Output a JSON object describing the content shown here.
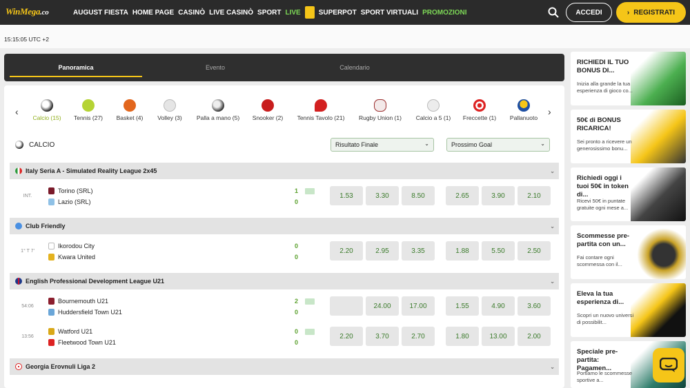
{
  "header": {
    "logo_main": "WinMega",
    "logo_suffix": ".co",
    "nav": [
      "AUGUST FIESTA",
      "HOME PAGE",
      "CASINÒ",
      "LIVE CASINÒ",
      "SPORT",
      "LIVE",
      "SUPERPOT",
      "SPORT VIRTUALI",
      "PROMOZIONI"
    ],
    "login": "ACCEDI",
    "register": "REGISTRATI",
    "accent": "#f5c518"
  },
  "time": "15:15:05 UTC +2",
  "tabs": [
    "Panoramica",
    "Evento",
    "Calendario"
  ],
  "sports": [
    {
      "label": "Calcio (15)",
      "icon": "soccer-ball-icon"
    },
    {
      "label": "Tennis (27)",
      "icon": "tennis-ball-icon"
    },
    {
      "label": "Basket (4)",
      "icon": "basketball-icon"
    },
    {
      "label": "Volley (3)",
      "icon": "volleyball-icon"
    },
    {
      "label": "Palla a mano (5)",
      "icon": "handball-icon"
    },
    {
      "label": "Snooker (2)",
      "icon": "snooker-ball-icon"
    },
    {
      "label": "Tennis Tavolo (21)",
      "icon": "table-tennis-icon"
    },
    {
      "label": "Rugby Union (1)",
      "icon": "rugby-ball-icon"
    },
    {
      "label": "Calcio a 5 (1)",
      "icon": "futsal-ball-icon"
    },
    {
      "label": "Freccette (1)",
      "icon": "darts-icon"
    },
    {
      "label": "Pallanuoto",
      "icon": "water-polo-icon"
    }
  ],
  "section": {
    "title": "CALCIO",
    "select1": "Risultato Finale",
    "select2": "Prossimo Goal"
  },
  "leagues": [
    {
      "name": "Italy Seria A - Simulated Reality League 2x45"
    },
    {
      "name": "Club Friendly"
    },
    {
      "name": "English Professional Development League U21"
    },
    {
      "name": "Georgia Erovnuli Liga 2"
    }
  ],
  "matches": [
    {
      "time": "INT.",
      "home": "Torino (SRL)",
      "away": "Lazio (SRL)",
      "score_home": "1",
      "score_away": "0",
      "odds1": [
        "1.53",
        "3.30",
        "8.50"
      ],
      "odds2": [
        "2.65",
        "3.90",
        "2.10"
      ]
    },
    {
      "time": "1° T 7'",
      "home": "Ikorodou City",
      "away": "Kwara United",
      "score_home": "0",
      "score_away": "0",
      "odds1": [
        "2.20",
        "2.95",
        "3.35"
      ],
      "odds2": [
        "1.88",
        "5.50",
        "2.50"
      ]
    },
    {
      "time": "54:06",
      "home": "Bournemouth U21",
      "away": "Huddersfield Town U21",
      "score_home": "2",
      "score_away": "0",
      "odds1": [
        "",
        "24.00",
        "17.00"
      ],
      "odds2": [
        "1.55",
        "4.90",
        "3.60"
      ]
    },
    {
      "time": "13:56",
      "home": "Watford U21",
      "away": "Fleetwood Town U21",
      "score_home": "0",
      "score_away": "0",
      "odds1": [
        "2.20",
        "3.70",
        "2.70"
      ],
      "odds2": [
        "1.80",
        "13.00",
        "2.00"
      ]
    }
  ],
  "promos": [
    {
      "title": "RICHIEDI IL TUO BONUS DI...",
      "desc": "Inizia alla grande la tua esperienza di gioco co..."
    },
    {
      "title": "50€ di BONUS RICARICA!",
      "desc": "Sei pronto a ricevere un generosissimo bonu..."
    },
    {
      "title": "Richiedi oggi i tuoi 50€ in token di...",
      "desc": "Ricevi 50€ in puntate gratuite ogni mese a..."
    },
    {
      "title": "Scommesse pre-partita con un...",
      "desc": "Fai contare ogni scommessa con il..."
    },
    {
      "title": "Eleva la tua esperienza di...",
      "desc": "Scopri un nuovo universi di possibilit..."
    },
    {
      "title": "Speciale pre-partita: Pagamen...",
      "desc": "Portiamo le scommesse sportive a..."
    }
  ]
}
